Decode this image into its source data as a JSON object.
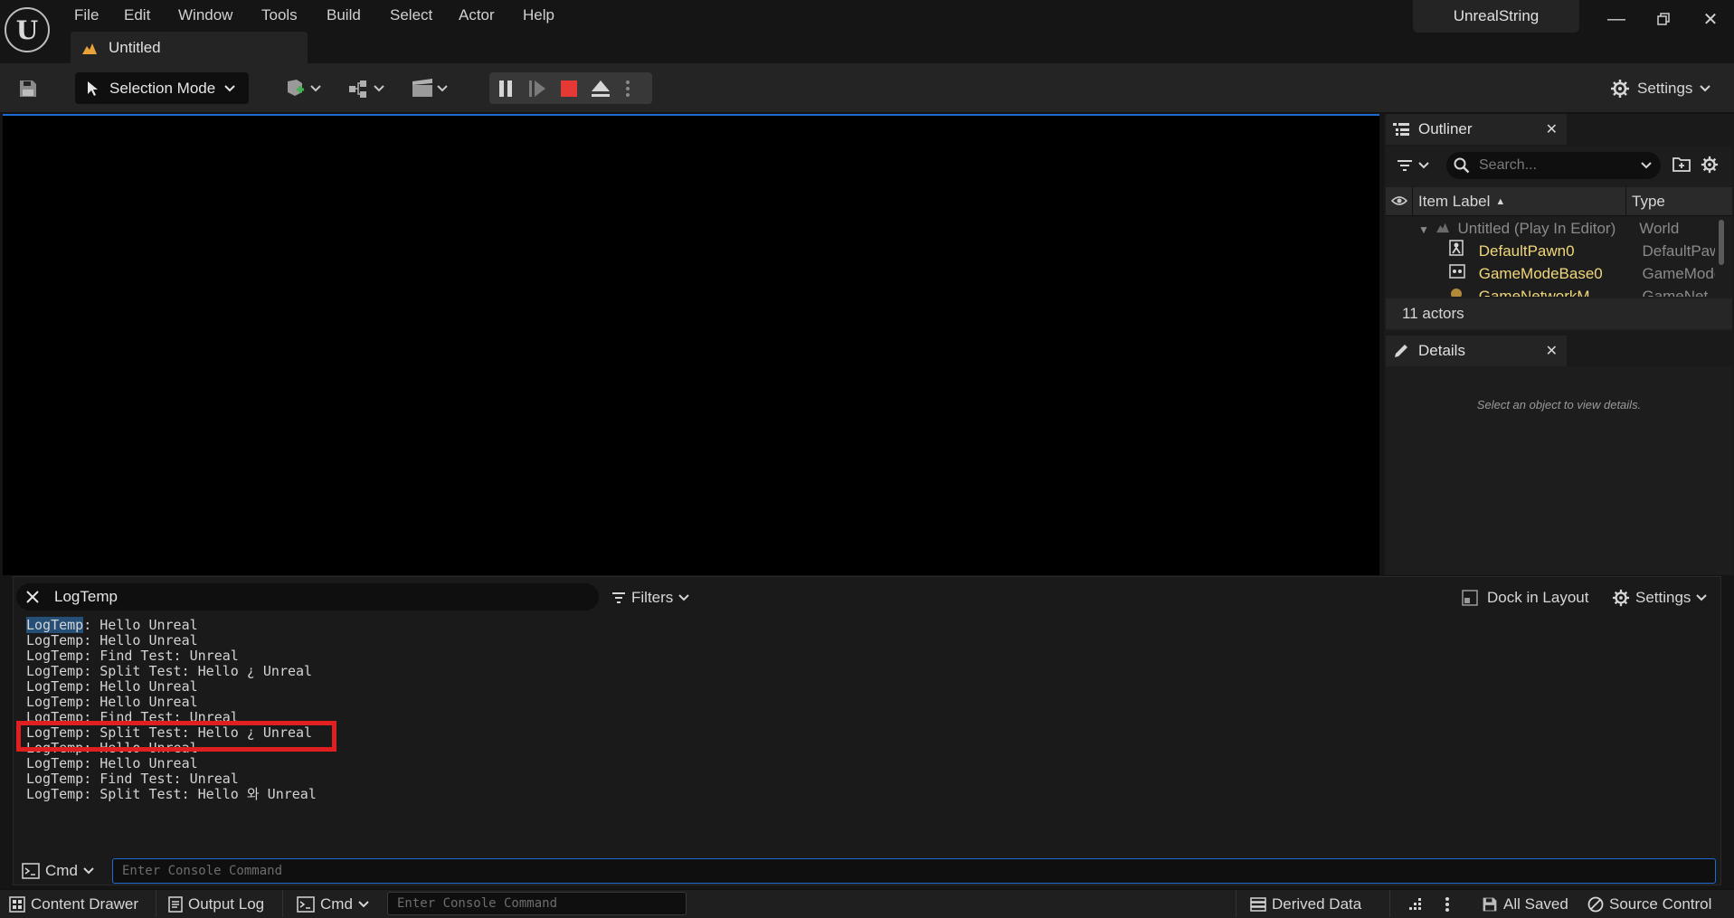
{
  "app": {
    "menu": [
      "File",
      "Edit",
      "Window",
      "Tools",
      "Build",
      "Select",
      "Actor",
      "Help"
    ],
    "document_tab": "Untitled",
    "project_name": "UnrealString"
  },
  "toolbar": {
    "selection_mode": "Selection Mode",
    "settings": "Settings"
  },
  "outliner": {
    "tab_label": "Outliner",
    "search_placeholder": "Search...",
    "col_label": "Item Label",
    "col_type": "Type",
    "rows": [
      {
        "label": "Untitled (Play In Editor)",
        "type": "World"
      },
      {
        "label": "DefaultPawn0",
        "type": "DefaultPaw"
      },
      {
        "label": "GameModeBase0",
        "type": "GameMode"
      },
      {
        "label": "GameNetworkM...",
        "type": "GameNet..."
      }
    ],
    "actor_count": "11 actors"
  },
  "details": {
    "tab_label": "Details",
    "empty_message": "Select an object to view details."
  },
  "output_log": {
    "filter_text": "LogTemp",
    "filters_label": "Filters",
    "dock_label": "Dock in Layout",
    "settings_label": "Settings",
    "lines": [
      "LogTemp: Hello Unreal",
      "LogTemp: Hello Unreal",
      "LogTemp: Find Test: Unreal",
      "LogTemp: Split Test: Hello ¿ Unreal",
      "LogTemp: Hello Unreal",
      "LogTemp: Hello Unreal",
      "LogTemp: Find Test: Unreal",
      "LogTemp: Split Test: Hello ¿ Unreal",
      "LogTemp: Hello Unreal",
      "LogTemp: Hello Unreal",
      "LogTemp: Find Test: Unreal",
      "LogTemp: Split Test: Hello 와 Unreal"
    ],
    "cmd_label": "Cmd",
    "cmd_placeholder": "Enter Console Command"
  },
  "statusbar": {
    "content_drawer": "Content Drawer",
    "output_log": "Output Log",
    "cmd_label": "Cmd",
    "cmd_placeholder": "Enter Console Command",
    "derived_data": "Derived Data",
    "all_saved": "All Saved",
    "source_control": "Source Control"
  },
  "colors": {
    "accent": "#1f6ad1",
    "highlight_box": "#e02020",
    "stop_red": "#e53935",
    "actor_yellow": "#f0d77a"
  }
}
